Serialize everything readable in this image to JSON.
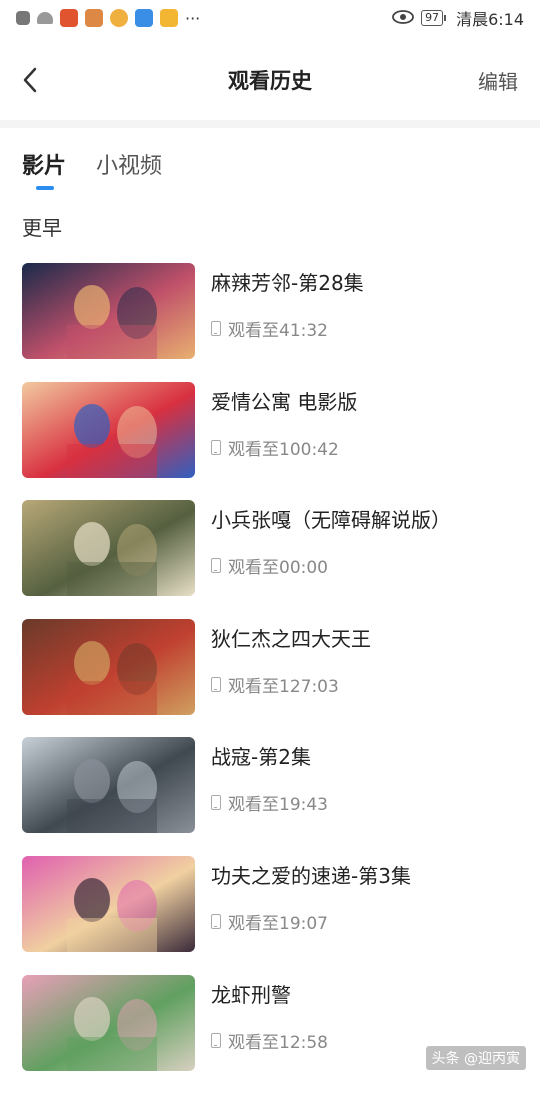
{
  "status_bar": {
    "dots": "···",
    "battery": "97",
    "time": "清晨6:14"
  },
  "header": {
    "title": "观看历史",
    "edit_label": "编辑"
  },
  "tabs": [
    {
      "label": "影片",
      "active": true
    },
    {
      "label": "小视频",
      "active": false
    }
  ],
  "section_title": "更早",
  "history": [
    {
      "title": "麻辣芳邻-第28集",
      "progress": "观看至41:32",
      "colors": [
        "#1a2a4a",
        "#c0506a",
        "#e8b070"
      ]
    },
    {
      "title": "爱情公寓 电影版",
      "progress": "观看至100:42",
      "colors": [
        "#f2c9a0",
        "#d83040",
        "#3060c0"
      ]
    },
    {
      "title": "小兵张嘎（无障碍解说版）",
      "progress": "观看至00:00",
      "colors": [
        "#b8a878",
        "#556040",
        "#e8e0c8"
      ]
    },
    {
      "title": "狄仁杰之四大天王",
      "progress": "观看至127:03",
      "colors": [
        "#6a3a2a",
        "#c04030",
        "#d0a060"
      ]
    },
    {
      "title": "战寇-第2集",
      "progress": "观看至19:43",
      "colors": [
        "#c8d0d8",
        "#404850",
        "#8a9098"
      ]
    },
    {
      "title": "功夫之爱的速递-第3集",
      "progress": "观看至19:07",
      "colors": [
        "#e060b0",
        "#f0d0a0",
        "#3a2a3a"
      ]
    },
    {
      "title": "龙虾刑警",
      "progress": "观看至12:58",
      "colors": [
        "#e8a0b8",
        "#60a060",
        "#d8d0c0"
      ]
    }
  ],
  "watermark": "头条 @迎丙寅"
}
